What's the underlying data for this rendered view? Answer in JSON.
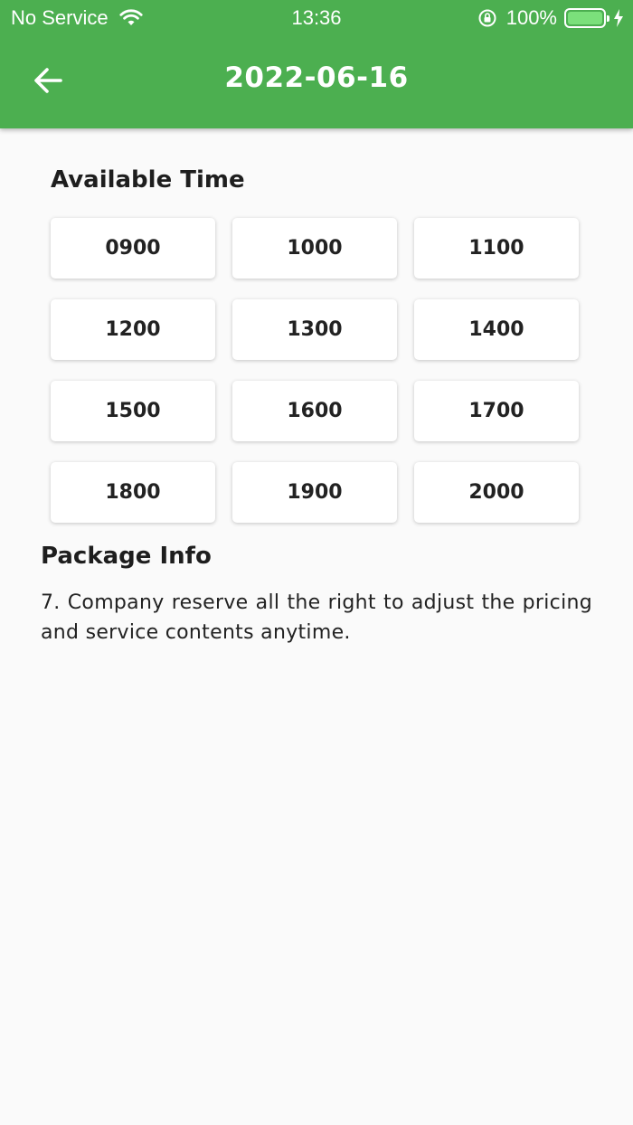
{
  "status_bar": {
    "carrier": "No Service",
    "time": "13:36",
    "battery": "100%"
  },
  "app_bar": {
    "title": "2022-06-16",
    "back_icon": "arrow-left-icon"
  },
  "available_time": {
    "title": "Available Time",
    "slots": [
      "0900",
      "1000",
      "1100",
      "1200",
      "1300",
      "1400",
      "1500",
      "1600",
      "1700",
      "1800",
      "1900",
      "2000"
    ]
  },
  "package_info": {
    "title": "Package Info",
    "text": "7. Company reserve all the right to adjust the pricing and service  contents anytime."
  },
  "colors": {
    "primary": "#4caf50",
    "background": "#fafafa",
    "card": "#ffffff"
  }
}
